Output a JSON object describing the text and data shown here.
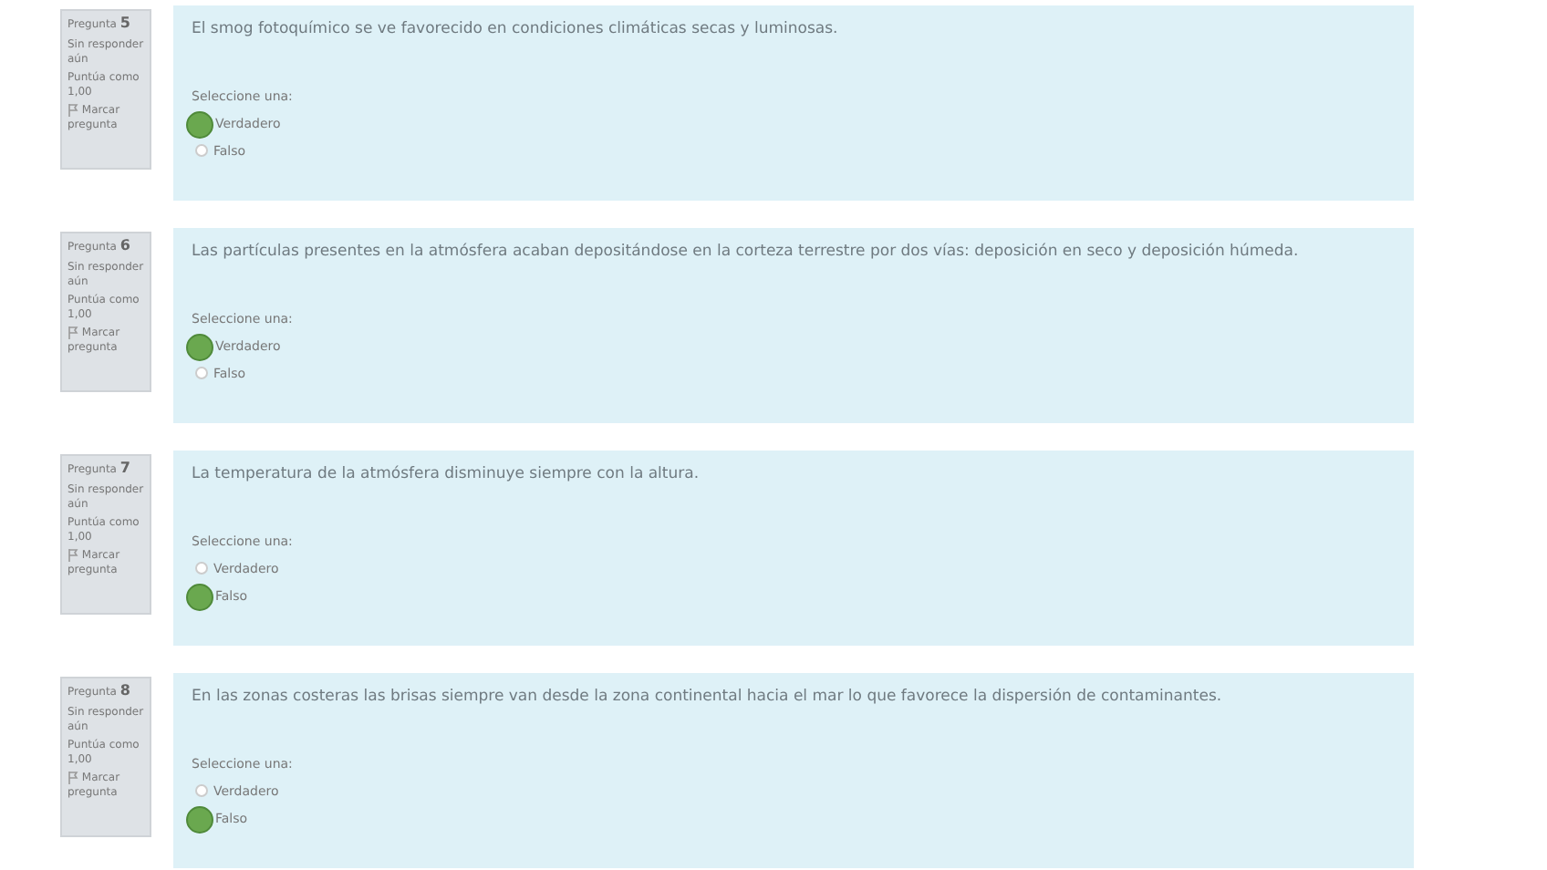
{
  "questions": [
    {
      "number": "Pregunta **5**",
      "status": "Sin responder aún",
      "grade": "Puntúa como 1,00",
      "flag": "Marcar pregunta",
      "text": "El smog fotoquímico se ve favorecido en condiciones climáticas secas y luminosas.",
      "prompt": "Seleccione una:",
      "options": [
        {
          "label": "Verdadero",
          "selected": true
        },
        {
          "label": "Falso",
          "selected": false
        }
      ]
    },
    {
      "number": "Pregunta **6**",
      "status": "Sin responder aún",
      "grade": "Puntúa como 1,00",
      "flag": "Marcar pregunta",
      "text": "Las partículas presentes en la atmósfera acaban depositándose en la corteza terrestre por dos vías: deposición en seco y deposición húmeda.",
      "prompt": "Seleccione una:",
      "options": [
        {
          "label": "Verdadero",
          "selected": true
        },
        {
          "label": "Falso",
          "selected": false
        }
      ]
    },
    {
      "number": "Pregunta **7**",
      "status": "Sin responder aún",
      "grade": "Puntúa como 1,00",
      "flag": "Marcar pregunta",
      "text": "La temperatura de la atmósfera disminuye siempre con la altura.",
      "prompt": "Seleccione una:",
      "options": [
        {
          "label": "Verdadero",
          "selected": false
        },
        {
          "label": "Falso",
          "selected": true
        }
      ]
    },
    {
      "number": "Pregunta **8**",
      "status": "Sin responder aún",
      "grade": "Puntúa como 1,00",
      "flag": "Marcar pregunta",
      "text": "En las zonas costeras las brisas siempre van desde la zona continental hacia el mar lo que favorece la dispersión de contaminantes.",
      "prompt": "Seleccione una:",
      "options": [
        {
          "label": "Verdadero",
          "selected": false
        },
        {
          "label": "Falso",
          "selected": true
        }
      ]
    }
  ]
}
